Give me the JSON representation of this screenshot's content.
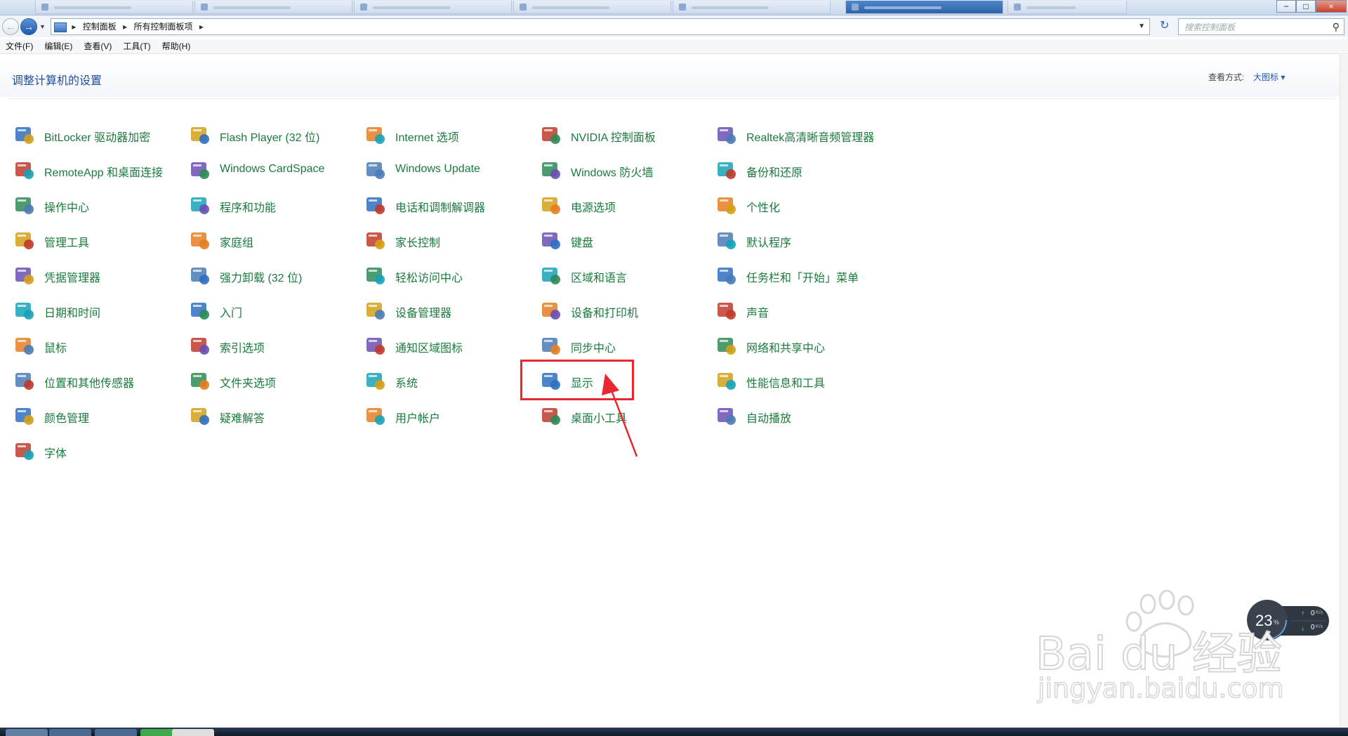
{
  "window": {
    "minimize": "−",
    "maximize": "□",
    "close": "×"
  },
  "address": {
    "crumbs": [
      "控制面板",
      "所有控制面板项"
    ],
    "search_placeholder": "搜索控制面板"
  },
  "menu": [
    "文件(F)",
    "编辑(E)",
    "查看(V)",
    "工具(T)",
    "帮助(H)"
  ],
  "header": {
    "title": "调整计算机的设置",
    "view_label": "查看方式:",
    "view_value": "大图标 ▾"
  },
  "items": [
    [
      "BitLocker 驱动器加密",
      "RemoteApp 和桌面连接",
      "操作中心",
      "管理工具",
      "凭据管理器",
      "日期和时间",
      "鼠标",
      "位置和其他传感器",
      "颜色管理",
      "字体"
    ],
    [
      "Flash Player (32 位)",
      "Windows CardSpace",
      "程序和功能",
      "家庭组",
      "强力卸载 (32 位)",
      "入门",
      "索引选项",
      "文件夹选项",
      "疑难解答"
    ],
    [
      "Internet 选项",
      "Windows Update",
      "电话和调制解调器",
      "家长控制",
      "轻松访问中心",
      "设备管理器",
      "通知区域图标",
      "系统",
      "用户帐户"
    ],
    [
      "NVIDIA 控制面板",
      "Windows 防火墙",
      "电源选项",
      "键盘",
      "区域和语言",
      "设备和打印机",
      "同步中心",
      "显示",
      "桌面小工具"
    ],
    [
      "Realtek高清晰音频管理器",
      "备份和还原",
      "个性化",
      "默认程序",
      "任务栏和「开始」菜单",
      "声音",
      "网络和共享中心",
      "性能信息和工具",
      "自动播放"
    ]
  ],
  "icons": [
    [
      "bitlocker-icon",
      "remoteapp-icon",
      "action-center-flag-icon",
      "admin-tools-icon",
      "credential-vault-icon",
      "calendar-clock-icon",
      "mouse-icon",
      "location-sensor-icon",
      "color-management-icon",
      "fonts-folder-icon"
    ],
    [
      "flash-icon",
      "cardspace-icon",
      "programs-icon",
      "homegroup-icon",
      "uninstaller-icon",
      "getting-started-icon",
      "index-search-icon",
      "folder-options-icon",
      "troubleshoot-icon"
    ],
    [
      "internet-options-icon",
      "windows-update-icon",
      "phone-modem-icon",
      "parental-controls-icon",
      "ease-of-access-icon",
      "device-manager-icon",
      "notification-icons-icon",
      "system-icon",
      "user-accounts-icon"
    ],
    [
      "nvidia-icon",
      "firewall-icon",
      "power-options-icon",
      "keyboard-icon",
      "region-language-icon",
      "devices-printers-icon",
      "sync-center-icon",
      "display-icon",
      "gadgets-icon"
    ],
    [
      "realtek-audio-icon",
      "backup-restore-icon",
      "personalization-icon",
      "default-programs-icon",
      "taskbar-start-icon",
      "sound-icon",
      "network-sharing-icon",
      "performance-icon",
      "autoplay-icon"
    ]
  ],
  "net_widget": {
    "percent": "23",
    "unit": "%",
    "up": "0",
    "down": "0",
    "rate_unit": "K/s"
  },
  "watermark": {
    "logo": "Bai du 经验",
    "url": "jingyan.baidu.com"
  },
  "colors": {
    "item_text": "#1a7a3c",
    "title": "#1e4ea1",
    "annotation": "#e8282e"
  }
}
